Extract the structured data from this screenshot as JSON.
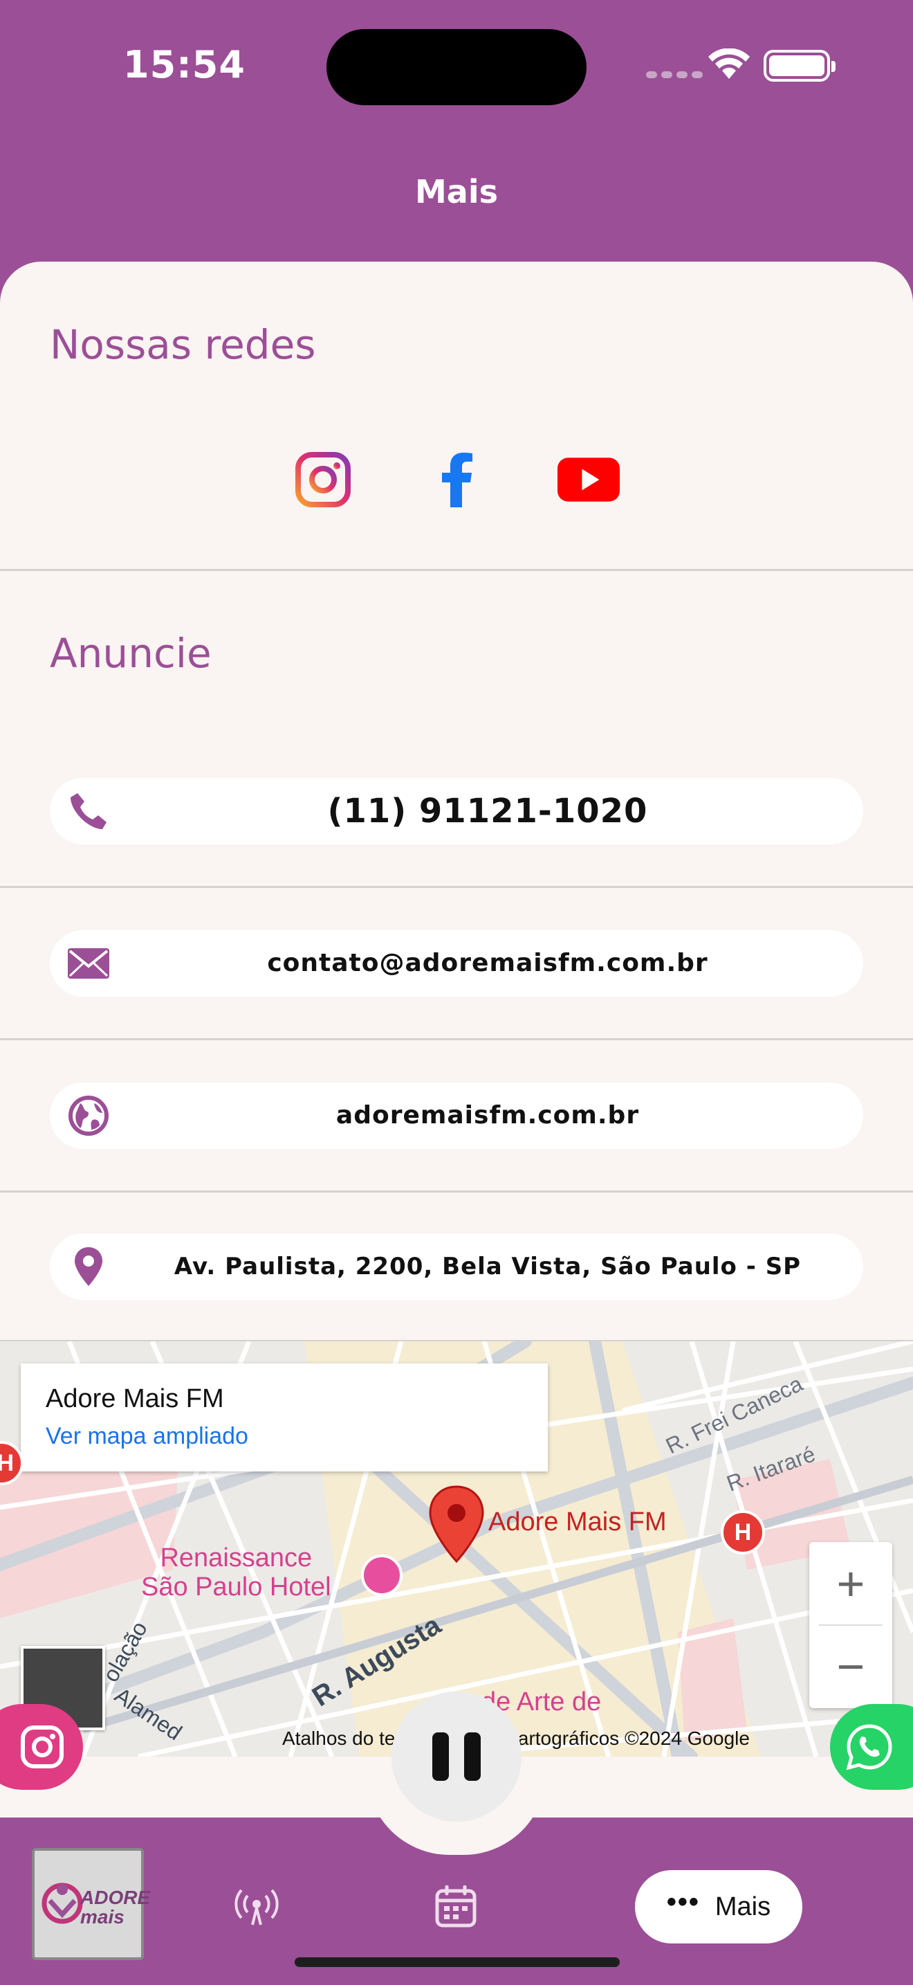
{
  "status_bar": {
    "time": "15:54"
  },
  "header": {
    "title": "Mais"
  },
  "social": {
    "title": "Nossas redes",
    "items": [
      {
        "name": "instagram",
        "icon": "instagram-icon"
      },
      {
        "name": "facebook",
        "icon": "facebook-icon"
      },
      {
        "name": "youtube",
        "icon": "youtube-icon"
      }
    ]
  },
  "advertise": {
    "title": "Anuncie",
    "phone": "(11) 91121-1020",
    "email": "contato@adoremaisfm.com.br",
    "website": "adoremaisfm.com.br",
    "address": "Av. Paulista, 2200, Bela Vista, São Paulo - SP"
  },
  "map": {
    "place_name": "Adore Mais FM",
    "open_link": "Ver mapa ampliado",
    "marker_label": "Adore Mais FM",
    "poi_hotel": "Renaissance\nSão Paulo Hotel",
    "street_frei_caneca": "R. Frei Caneca",
    "street_itarare": "R. Itararé",
    "street_augusta": "R. Augusta",
    "street_alameda": "Alamed",
    "street_consolacao": "olação",
    "poi_arte": "de Arte de",
    "attribution": "Atalhos do teclado   Dados cartográficos ©2024 Google",
    "zoom_in": "+",
    "zoom_out": "−"
  },
  "colors": {
    "brand": "#9b4f96",
    "background": "#faf4f2",
    "instagram_fab": "#e03c83",
    "whatsapp_fab": "#25d366"
  },
  "bottom_nav": {
    "logo_text": "ADORE mais",
    "more_label": "Mais"
  }
}
